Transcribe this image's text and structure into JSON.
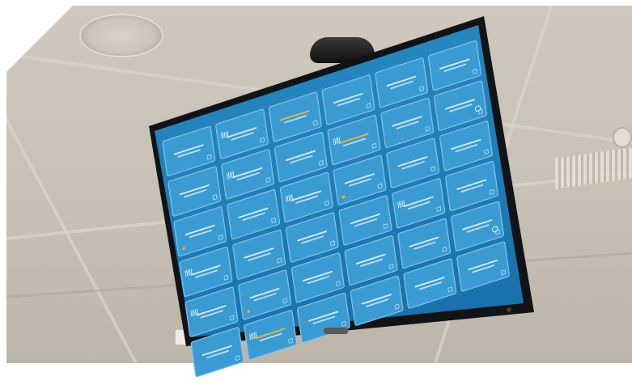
{
  "scene": {
    "colors": {
      "screen": "#2b8ec4",
      "tile": "#3a9bd3",
      "tile_border": "#8cc9ec",
      "warning": "#f4b23a",
      "bezel": "#121316",
      "ceiling": "#cfc8bd"
    }
  },
  "dashboard": {
    "tiles": [
      {
        "id": "t01",
        "state": "normal"
      },
      {
        "id": "t02",
        "state": "normal",
        "bars": true
      },
      {
        "id": "t03",
        "state": "warning"
      },
      {
        "id": "t04",
        "state": "normal"
      },
      {
        "id": "t05",
        "state": "normal"
      },
      {
        "id": "t06",
        "state": "normal"
      },
      {
        "id": "t07",
        "state": "normal"
      },
      {
        "id": "t08",
        "state": "normal",
        "bars": true
      },
      {
        "id": "t09",
        "state": "normal"
      },
      {
        "id": "t10",
        "state": "warning",
        "bars": true
      },
      {
        "id": "t11",
        "state": "normal"
      },
      {
        "id": "t12",
        "state": "normal",
        "circle": true
      },
      {
        "id": "t13",
        "state": "normal",
        "dot": true
      },
      {
        "id": "t14",
        "state": "normal"
      },
      {
        "id": "t15",
        "state": "normal",
        "bars": true
      },
      {
        "id": "t16",
        "state": "normal",
        "dot": true
      },
      {
        "id": "t17",
        "state": "normal"
      },
      {
        "id": "t18",
        "state": "normal"
      },
      {
        "id": "t19",
        "state": "normal",
        "bars": true
      },
      {
        "id": "t20",
        "state": "normal"
      },
      {
        "id": "t21",
        "state": "normal"
      },
      {
        "id": "t22",
        "state": "normal"
      },
      {
        "id": "t23",
        "state": "normal",
        "bars": true
      },
      {
        "id": "t24",
        "state": "normal"
      },
      {
        "id": "t25",
        "state": "normal",
        "bars": true
      },
      {
        "id": "t26",
        "state": "normal",
        "dot": true
      },
      {
        "id": "t27",
        "state": "normal"
      },
      {
        "id": "t28",
        "state": "normal"
      },
      {
        "id": "t29",
        "state": "normal"
      },
      {
        "id": "t30",
        "state": "normal",
        "circle": true
      },
      {
        "id": "t31",
        "state": "normal"
      },
      {
        "id": "t32",
        "state": "warning",
        "bars": true
      },
      {
        "id": "t33",
        "state": "normal"
      },
      {
        "id": "t34",
        "state": "normal"
      },
      {
        "id": "t35",
        "state": "normal"
      },
      {
        "id": "t36",
        "state": "normal"
      }
    ]
  }
}
